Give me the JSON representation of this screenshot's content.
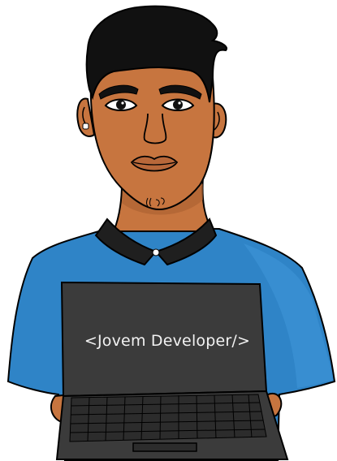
{
  "laptop": {
    "screen_text": "<Jovem Developer/>"
  },
  "colors": {
    "skin": "#c7753f",
    "skin_shadow": "#a85f31",
    "hair": "#111111",
    "shirt": "#2f84c7",
    "shirt_light": "#3f98d8",
    "collar": "#1f1f1f",
    "laptop_body": "#3b3b3b",
    "laptop_keyboard": "#2c2c2c",
    "outline": "#000000"
  },
  "icons": [
    "earring-icon",
    "collar-button-icon",
    "touchpad-icon"
  ]
}
